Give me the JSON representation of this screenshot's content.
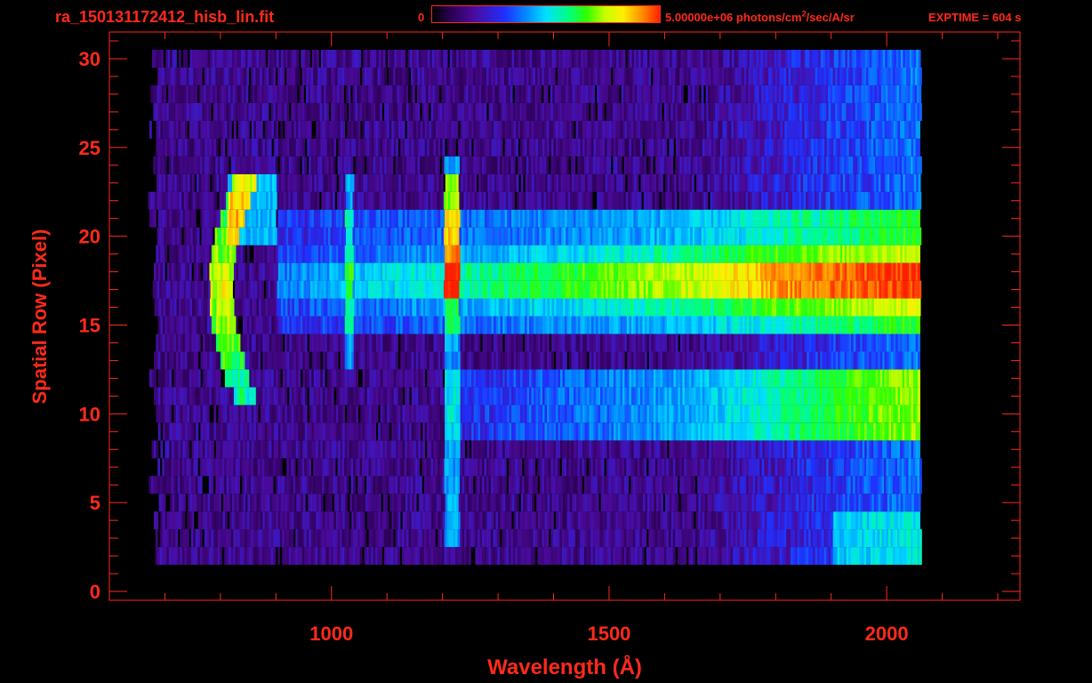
{
  "header": {
    "filename": "ra_150131172412_hisb_lin.fit",
    "colorbar_min": "0",
    "colorbar_max_part1": "5.00000e+06 photons/cm",
    "colorbar_max_sup": "2",
    "colorbar_max_part2": "/sec/A/sr",
    "exptime": "EXPTIME = 604 s"
  },
  "colors": {
    "axis": "#ff2a1a",
    "background": "#000000",
    "colormap": [
      "#000000",
      "#2a0050",
      "#4a0a9a",
      "#2030ff",
      "#0090ff",
      "#00e0ff",
      "#00ff80",
      "#30ff00",
      "#c8ff00",
      "#ffee00",
      "#ff9000",
      "#ff2000"
    ]
  },
  "chart_data": {
    "type": "heatmap",
    "title": "ra_150131172412_hisb_lin.fit",
    "xlabel": "Wavelength (Å)",
    "ylabel": "Spatial Row (Pixel)",
    "xlim": [
      600,
      2240
    ],
    "ylim": [
      -0.5,
      31.5
    ],
    "xticks": [
      1000,
      1500,
      2000
    ],
    "yticks": [
      0,
      5,
      10,
      15,
      20,
      25,
      30
    ],
    "x_minor_step": 100,
    "y_minor_step": 1,
    "colorbar": {
      "min": 0,
      "max": 5000000,
      "units": "photons/cm²/sec/A/sr"
    },
    "data_x_range": [
      690,
      2060
    ],
    "data_y_range": [
      2,
      30
    ],
    "features": [
      {
        "name": "arc",
        "x_center": 870,
        "y_range": [
          11,
          23
        ]
      },
      {
        "name": "line",
        "x": 1030,
        "y_range": [
          13,
          23
        ]
      },
      {
        "name": "line",
        "x": 1215,
        "y_range": [
          3,
          24
        ]
      },
      {
        "name": "band",
        "y_range": [
          15,
          21
        ],
        "x_range": [
          900,
          2060
        ]
      },
      {
        "name": "band",
        "y_range": [
          9,
          12
        ],
        "x_range": [
          1200,
          2060
        ]
      }
    ]
  }
}
